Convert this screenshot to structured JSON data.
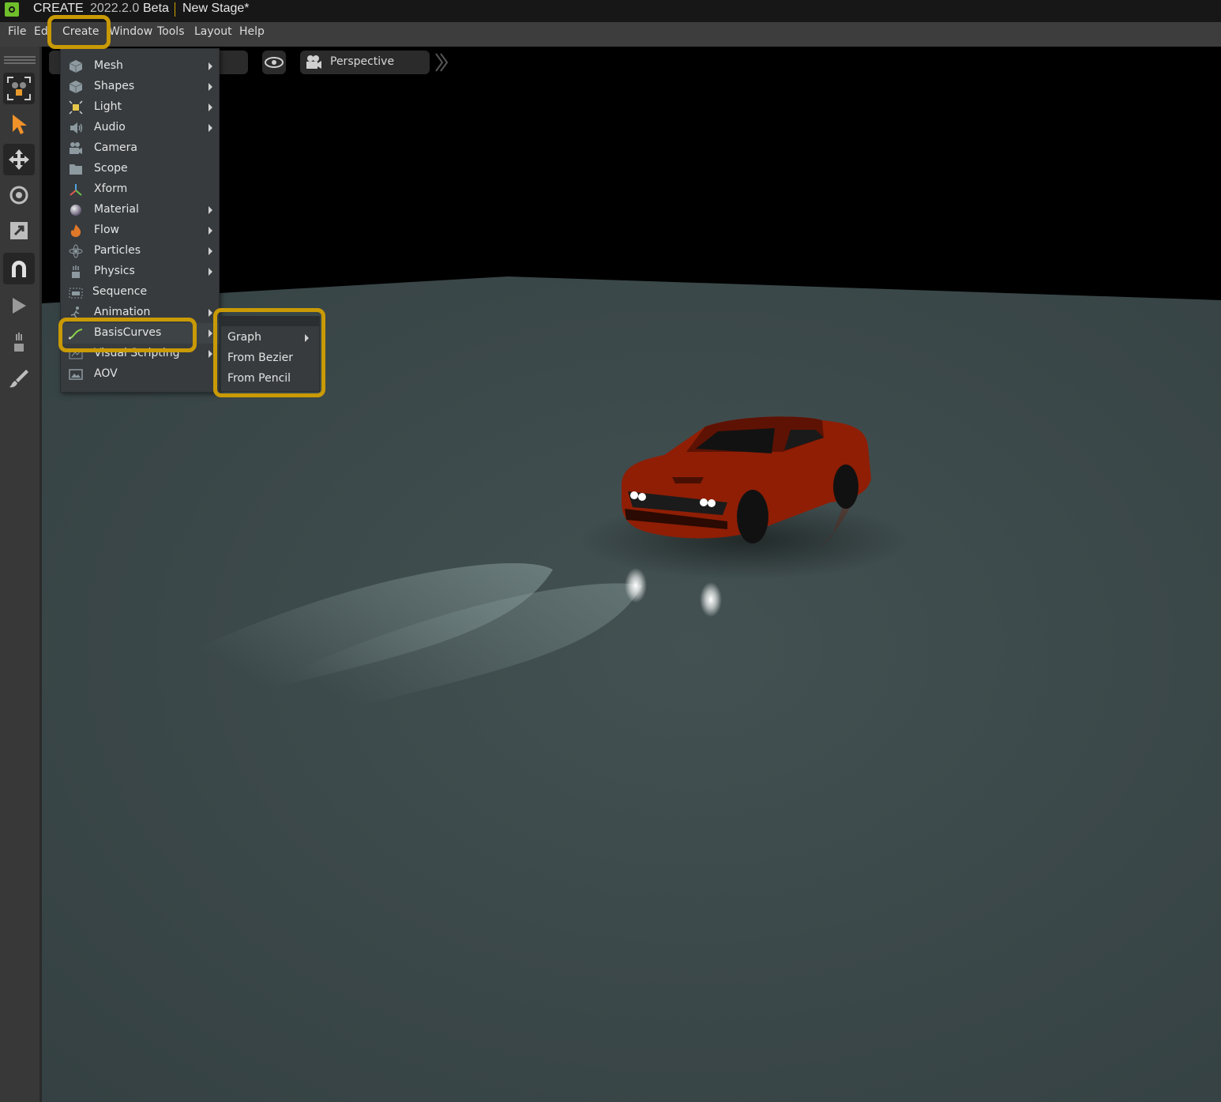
{
  "titlebar": {
    "app": "CREATE",
    "version": "2022.2.0",
    "channel": "Beta",
    "stage": "New Stage*"
  },
  "menubar": {
    "file": "File",
    "edit": "Ed",
    "create": "Create",
    "window": "Window",
    "tools": "Tools",
    "layout": "Layout",
    "help": "Help"
  },
  "viewport": {
    "camera": "Perspective"
  },
  "create_menu": [
    {
      "label": "Mesh",
      "icon": "cube-icon",
      "submenu": true
    },
    {
      "label": "Shapes",
      "icon": "cube-icon",
      "submenu": true
    },
    {
      "label": "Light",
      "icon": "light-icon",
      "submenu": true
    },
    {
      "label": "Audio",
      "icon": "speaker-icon",
      "submenu": true
    },
    {
      "label": "Camera",
      "icon": "camera-icon",
      "submenu": false
    },
    {
      "label": "Scope",
      "icon": "folder-icon",
      "submenu": false
    },
    {
      "label": "Xform",
      "icon": "axes-icon",
      "submenu": false
    },
    {
      "label": "Material",
      "icon": "sphere-icon",
      "submenu": true
    },
    {
      "label": "Flow",
      "icon": "flame-icon",
      "submenu": true
    },
    {
      "label": "Particles",
      "icon": "atom-icon",
      "submenu": true
    },
    {
      "label": "Physics",
      "icon": "physics-icon",
      "submenu": true
    },
    {
      "label": "Sequence",
      "icon": "sequence-icon",
      "submenu": false
    },
    {
      "label": "Animation",
      "icon": "animation-icon",
      "submenu": true
    },
    {
      "label": "BasisCurves",
      "icon": "curve-icon",
      "submenu": true
    },
    {
      "label": "Visual Scripting",
      "icon": "graph-icon",
      "submenu": true
    },
    {
      "label": "AOV",
      "icon": "image-icon",
      "submenu": false
    }
  ],
  "basis_curves_submenu": [
    {
      "label": "Graph",
      "submenu": true
    },
    {
      "label": "From Bezier",
      "submenu": false
    },
    {
      "label": "From Pencil",
      "submenu": false
    }
  ],
  "colors": {
    "highlight": "#c99a06",
    "car": "#8f1e05",
    "floor": "#3b4647"
  }
}
